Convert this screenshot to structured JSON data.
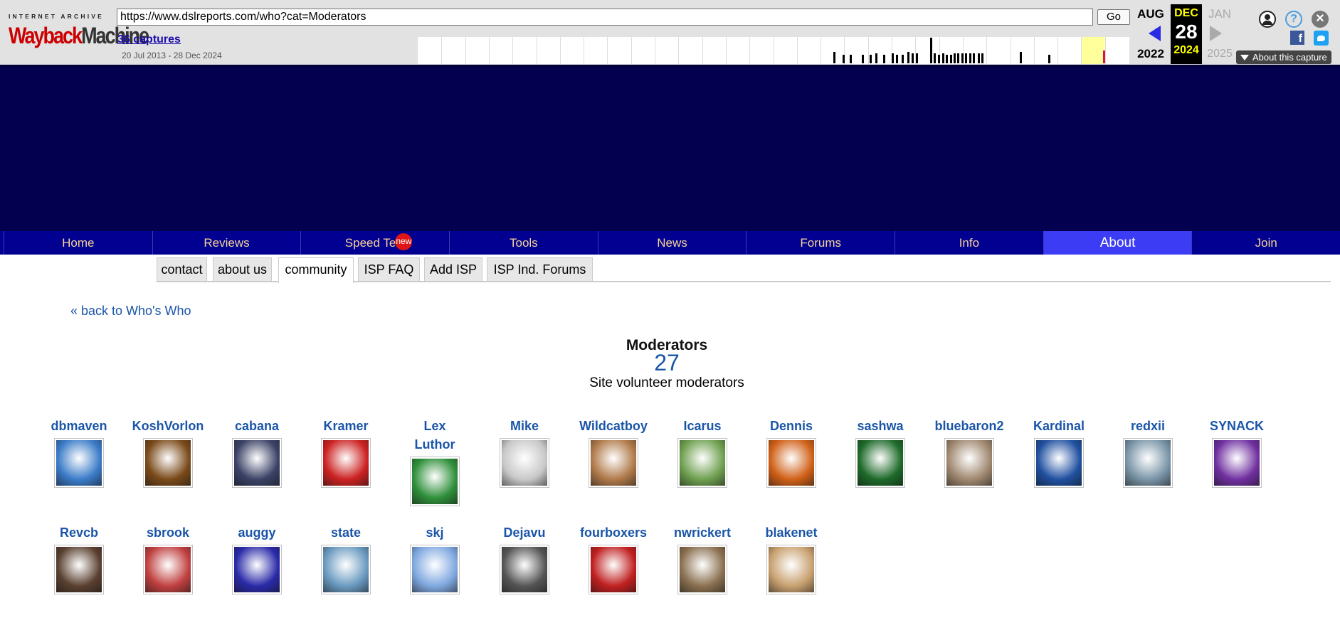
{
  "wayback": {
    "logo_top": "INTERNET ARCHIVE",
    "logo_main_a": "Wayback",
    "logo_main_b": "Machine",
    "url": "https://www.dslreports.com/who?cat=Moderators",
    "go_label": "Go",
    "captures": "36 captures",
    "range": "20 Jul 2013 - 28 Dec 2024",
    "prev_month": "AUG",
    "prev_year": "2022",
    "cur_month": "DEC",
    "cur_day": "28",
    "cur_year": "2024",
    "next_month": "JAN",
    "next_year": "2025",
    "about_capture": "About this capture",
    "icons": [
      "user-icon",
      "help-icon",
      "close-icon",
      "facebook-icon",
      "twitter-icon"
    ]
  },
  "nav": {
    "items": [
      "Home",
      "Reviews",
      "Speed Test",
      "Tools",
      "News",
      "Forums",
      "Info",
      "About",
      "Join"
    ],
    "active": "About",
    "new_badge": "new"
  },
  "subnav": {
    "items": [
      "contact",
      "about us",
      "community",
      "ISP FAQ",
      "Add ISP",
      "ISP Ind. Forums"
    ],
    "active": "community"
  },
  "main": {
    "back_link": "« back to Who's Who",
    "title": "Moderators",
    "count": "27",
    "description": "Site volunteer moderators"
  },
  "moderators": [
    {
      "name": "dbmaven",
      "color": "#3b7cc8"
    },
    {
      "name": "KoshVorlon",
      "color": "#7a4a1a"
    },
    {
      "name": "cabana",
      "color": "#3b4266"
    },
    {
      "name": "Kramer",
      "color": "#cc2222"
    },
    {
      "name": "Lex Luthor",
      "color": "#2f8f3a"
    },
    {
      "name": "Mike",
      "color": "#c8c8c8"
    },
    {
      "name": "Wildcatboy",
      "color": "#b07a4a"
    },
    {
      "name": "Icarus",
      "color": "#6fa050"
    },
    {
      "name": "Dennis",
      "color": "#d06018"
    },
    {
      "name": "sashwa",
      "color": "#1e6a2a"
    },
    {
      "name": "bluebaron2",
      "color": "#a08870"
    },
    {
      "name": "Kardinal",
      "color": "#2050a0"
    },
    {
      "name": "redxii",
      "color": "#7a95a8"
    },
    {
      "name": "SYNACK",
      "color": "#7030a0"
    },
    {
      "name": "Revcb",
      "color": "#5a4030"
    },
    {
      "name": "sbrook",
      "color": "#c04040"
    },
    {
      "name": "auggy",
      "color": "#2a2aa8"
    },
    {
      "name": "state",
      "color": "#6a9ac0"
    },
    {
      "name": "skj",
      "color": "#80a8e0"
    },
    {
      "name": "Dejavu",
      "color": "#555555"
    },
    {
      "name": "fourboxers",
      "color": "#c02020"
    },
    {
      "name": "nwrickert",
      "color": "#8a7050"
    },
    {
      "name": "blakenet",
      "color": "#c8a070"
    }
  ]
}
